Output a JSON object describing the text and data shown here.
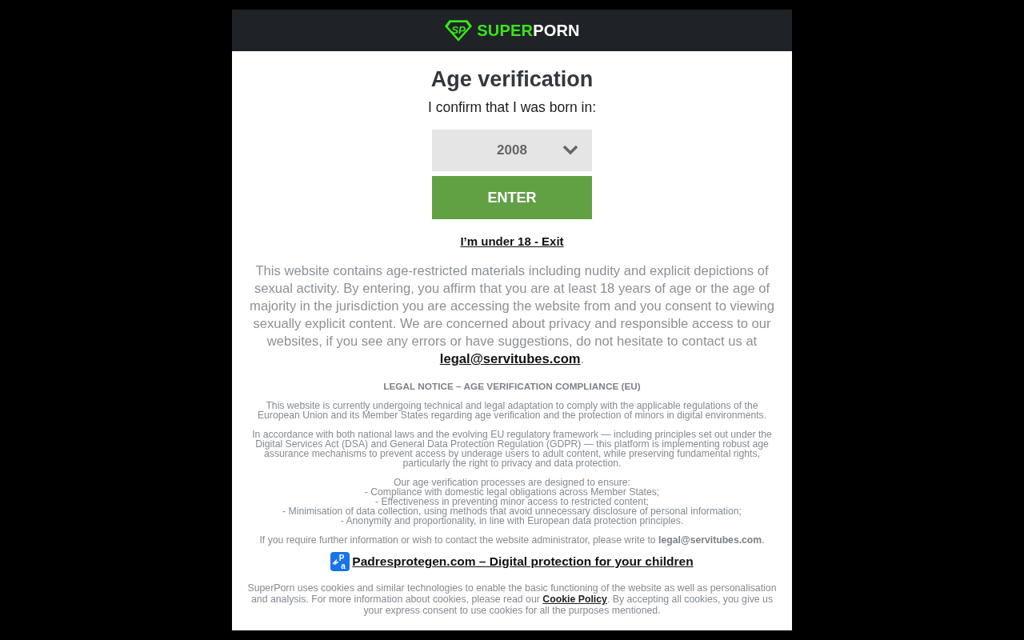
{
  "header": {
    "logo": {
      "mark": "SP",
      "accent_text": "SUPER",
      "text": "PORN"
    }
  },
  "title": "Age verification",
  "prompt": "I confirm that I was born in:",
  "year_select": {
    "value": "2008"
  },
  "enter_button": "ENTER",
  "exit_link": "I’m under 18 - Exit",
  "disclaimer": {
    "text": "This website contains age-restricted materials including nudity and explicit depictions of sexual activity. By entering, you affirm that you are at least 18 years of age or the age of majority in the jurisdiction you are accessing the website from and you consent to viewing sexually explicit content. We are concerned about privacy and responsible access to our websites, if you see any errors or have suggestions, do not hesitate to contact us at",
    "email_link": "legal@servitubes.com",
    "end": "."
  },
  "legal_notice": {
    "heading": "LEGAL NOTICE – AGE VERIFICATION COMPLIANCE (EU)",
    "paragraphs": [
      "This website is currently undergoing technical and legal adaptation to comply with the applicable regulations of the European Union and its Member States regarding age verification and the protection of minors in digital environments.",
      "In accordance with both national laws and the evolving EU regulatory framework — including principles set out under the Digital Services Act (DSA) and General Data Protection Regulation (GDPR) — this platform is implementing robust age assurance mechanisms to prevent access by underage users to adult content, while preserving fundamental rights, particularly the right to privacy and data protection."
    ],
    "list_intro": "Our age verification processes are designed to ensure:",
    "list_items": [
      "- Compliance with domestic legal obligations across Member States;",
      "- Effectiveness in preventing minor access to restricted content;",
      "- Minimisation of data collection, using methods that avoid unnecessary disclosure of personal information;",
      "- Anonymity and proportionality, in line with European data protection principles."
    ],
    "contact": "If you require further information or wish to contact the website administrator, please write to **legal@servitubes.com**."
  },
  "protection_link": {
    "logo_letters": "Pa",
    "label": "Padresprotegen.com – Digital protection for your children"
  },
  "cookie_notice": {
    "before": "SuperPorn uses cookies and similar technologies to enable the basic functioning of the website as well as personalisation and analysis. For more information about cookies, please read our ",
    "link": "Cookie Policy",
    "after": ". By accepting all cookies, you give us your express consent to use cookies for all the purposes mentioned."
  }
}
